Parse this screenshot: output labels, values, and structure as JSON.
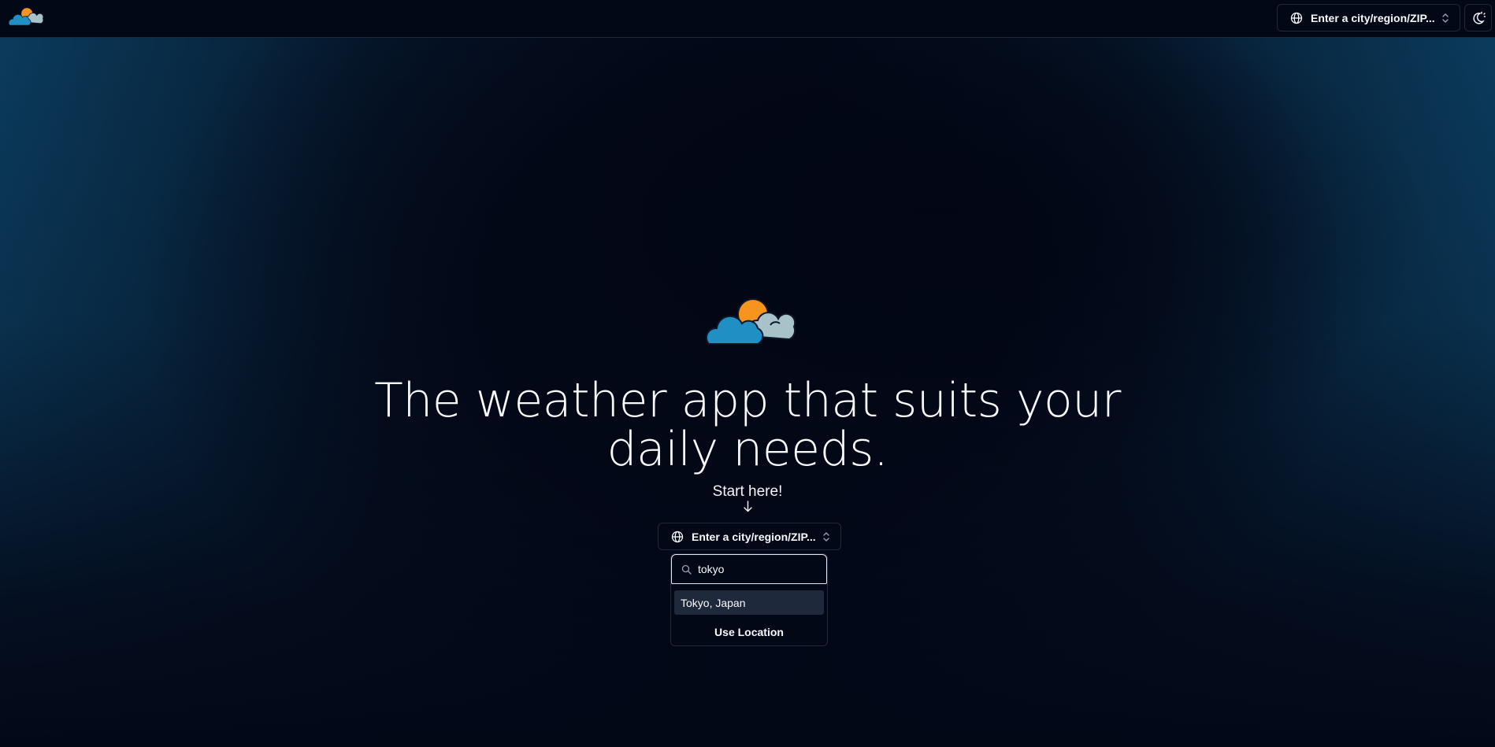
{
  "header": {
    "logo_icon": "cloud-sun-logo-icon",
    "location_combo": {
      "label": "Enter a city/region/ZIP...",
      "icon": "globe-icon",
      "chevron": "chevrons-up-down-icon"
    },
    "theme_toggle": {
      "icon": "moon-sun-theme-icon"
    }
  },
  "hero": {
    "logo_icon": "cloud-sun-logo-icon",
    "headline": "The weather app that suits your daily needs.",
    "cta": "Start here!",
    "arrow_icon": "arrow-down-icon",
    "location_combo": {
      "label": "Enter a city/region/ZIP...",
      "icon": "globe-icon",
      "chevron": "chevrons-up-down-icon"
    }
  },
  "dropdown": {
    "search_icon": "search-icon",
    "search_value": "tokyo",
    "results": [
      {
        "label": "Tokyo, Japan"
      }
    ],
    "use_location_label": "Use Location"
  },
  "colors": {
    "background": "#030817",
    "edge_glow": "#0b3b5c",
    "border": "#1e293b",
    "highlight": "#1e293b",
    "logo_sun": "#f7941d",
    "logo_cloud_front": "#1f8fc4",
    "logo_cloud_back": "#a7c3c9"
  }
}
